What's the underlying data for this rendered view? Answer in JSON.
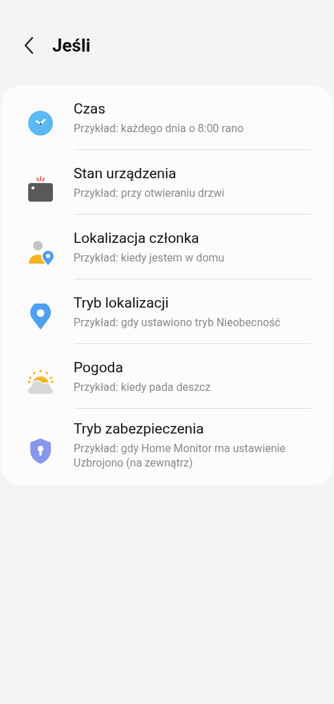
{
  "header": {
    "title": "Jeśli"
  },
  "items": [
    {
      "kind": "clock",
      "title": "Czas",
      "subtitle": "Przykład: każdego dnia o 8:00 rano"
    },
    {
      "kind": "device",
      "title": "Stan urządzenia",
      "subtitle": "Przykład: przy otwieraniu drzwi"
    },
    {
      "kind": "member",
      "title": "Lokalizacja członka",
      "subtitle": "Przykład: kiedy jestem w domu"
    },
    {
      "kind": "pin",
      "title": "Tryb lokalizacji",
      "subtitle": "Przykład: gdy ustawiono tryb Nieobecność"
    },
    {
      "kind": "weather",
      "title": "Pogoda",
      "subtitle": "Przykład: kiedy pada deszcz"
    },
    {
      "kind": "shield",
      "title": "Tryb zabezpieczenia",
      "subtitle": "Przykład: gdy Home Monitor ma ustawienie Uzbrojono (na zewnątrz)"
    }
  ]
}
